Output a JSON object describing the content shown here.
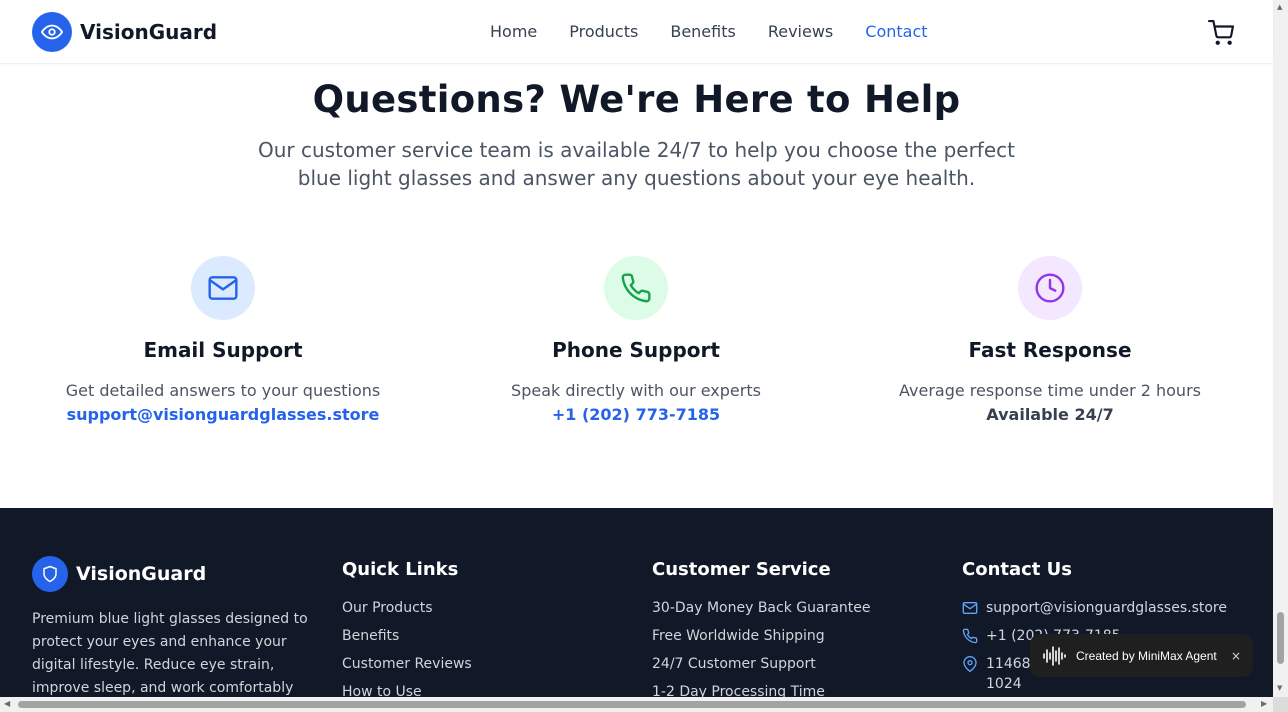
{
  "header": {
    "brand": "VisionGuard",
    "nav": [
      "Home",
      "Products",
      "Benefits",
      "Reviews",
      "Contact"
    ],
    "active_nav": "Contact"
  },
  "contact": {
    "title": "Questions? We're Here to Help",
    "subtitle": "Our customer service team is available 24/7 to help you choose the perfect blue light glasses and answer any questions about your eye health.",
    "cards": [
      {
        "title": "Email Support",
        "desc": "Get detailed answers to your questions",
        "value": "support@visionguardglasses.store",
        "icon": "mail-icon",
        "bg": "#dbeafe",
        "color": "#2563eb"
      },
      {
        "title": "Phone Support",
        "desc": "Speak directly with our experts",
        "value": "+1 (202) 773-7185",
        "icon": "phone-icon",
        "bg": "#dcfce7",
        "color": "#16a34a"
      },
      {
        "title": "Fast Response",
        "desc": "Average response time under 2 hours",
        "value": "Available 24/7",
        "icon": "clock-icon",
        "bg": "#f3e8ff",
        "color": "#9333ea"
      }
    ]
  },
  "footer": {
    "brand": "VisionGuard",
    "description": "Premium blue light glasses designed to protect your eyes and enhance your digital lifestyle. Reduce eye strain, improve sleep, and work comfortably",
    "quick_links": {
      "title": "Quick Links",
      "items": [
        "Our Products",
        "Benefits",
        "Customer Reviews",
        "How to Use"
      ]
    },
    "customer_service": {
      "title": "Customer Service",
      "items": [
        "30-Day Money Back Guarantee",
        "Free Worldwide Shipping",
        "24/7 Customer Support",
        "1-2 Day Processing Time"
      ]
    },
    "contact_us": {
      "title": "Contact Us",
      "email": "support@visionguardglasses.store",
      "phone": "+1 (202) 773-7185",
      "address": "11468 Marketplace Dr. N, Ste. 000 1024"
    }
  },
  "toast": {
    "text": "Created by MiniMax Agent",
    "close": "×"
  },
  "colors": {
    "accent": "#2563eb",
    "footer_bg": "#111827"
  }
}
